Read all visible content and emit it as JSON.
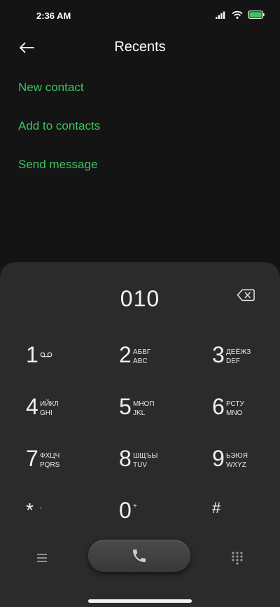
{
  "status_bar": {
    "time": "2:36 AM"
  },
  "header": {
    "title": "Recents"
  },
  "actions": [
    {
      "label": "New contact"
    },
    {
      "label": "Add to contacts"
    },
    {
      "label": "Send message"
    }
  ],
  "dialer": {
    "number": "010",
    "keys": [
      {
        "digit": "1",
        "top": "",
        "bottom": ""
      },
      {
        "digit": "2",
        "top": "АБВГ",
        "bottom": "ABC"
      },
      {
        "digit": "3",
        "top": "ДЕЁЖЗ",
        "bottom": "DEF"
      },
      {
        "digit": "4",
        "top": "ИЙКЛ",
        "bottom": "GHI"
      },
      {
        "digit": "5",
        "top": "МНОП",
        "bottom": "JKL"
      },
      {
        "digit": "6",
        "top": "РСТУ",
        "bottom": "MNO"
      },
      {
        "digit": "7",
        "top": "ФХЦЧ",
        "bottom": "PQRS"
      },
      {
        "digit": "8",
        "top": "ШЩЪЫ",
        "bottom": "TUV"
      },
      {
        "digit": "9",
        "top": "ЬЭЮЯ",
        "bottom": "WXYZ"
      },
      {
        "digit": "*",
        "sub": ","
      },
      {
        "digit": "0",
        "sub": "+"
      },
      {
        "digit": "#",
        "sub": ""
      }
    ]
  },
  "colors": {
    "accent": "#3bc55e",
    "background": "#141414",
    "dialer_bg": "#2b2b2b"
  },
  "icons": {
    "back": "arrow-left-icon",
    "backspace": "backspace-icon",
    "voicemail": "voicemail-icon",
    "menu": "menu-icon",
    "call": "phone-icon",
    "keypad": "keypad-icon"
  }
}
